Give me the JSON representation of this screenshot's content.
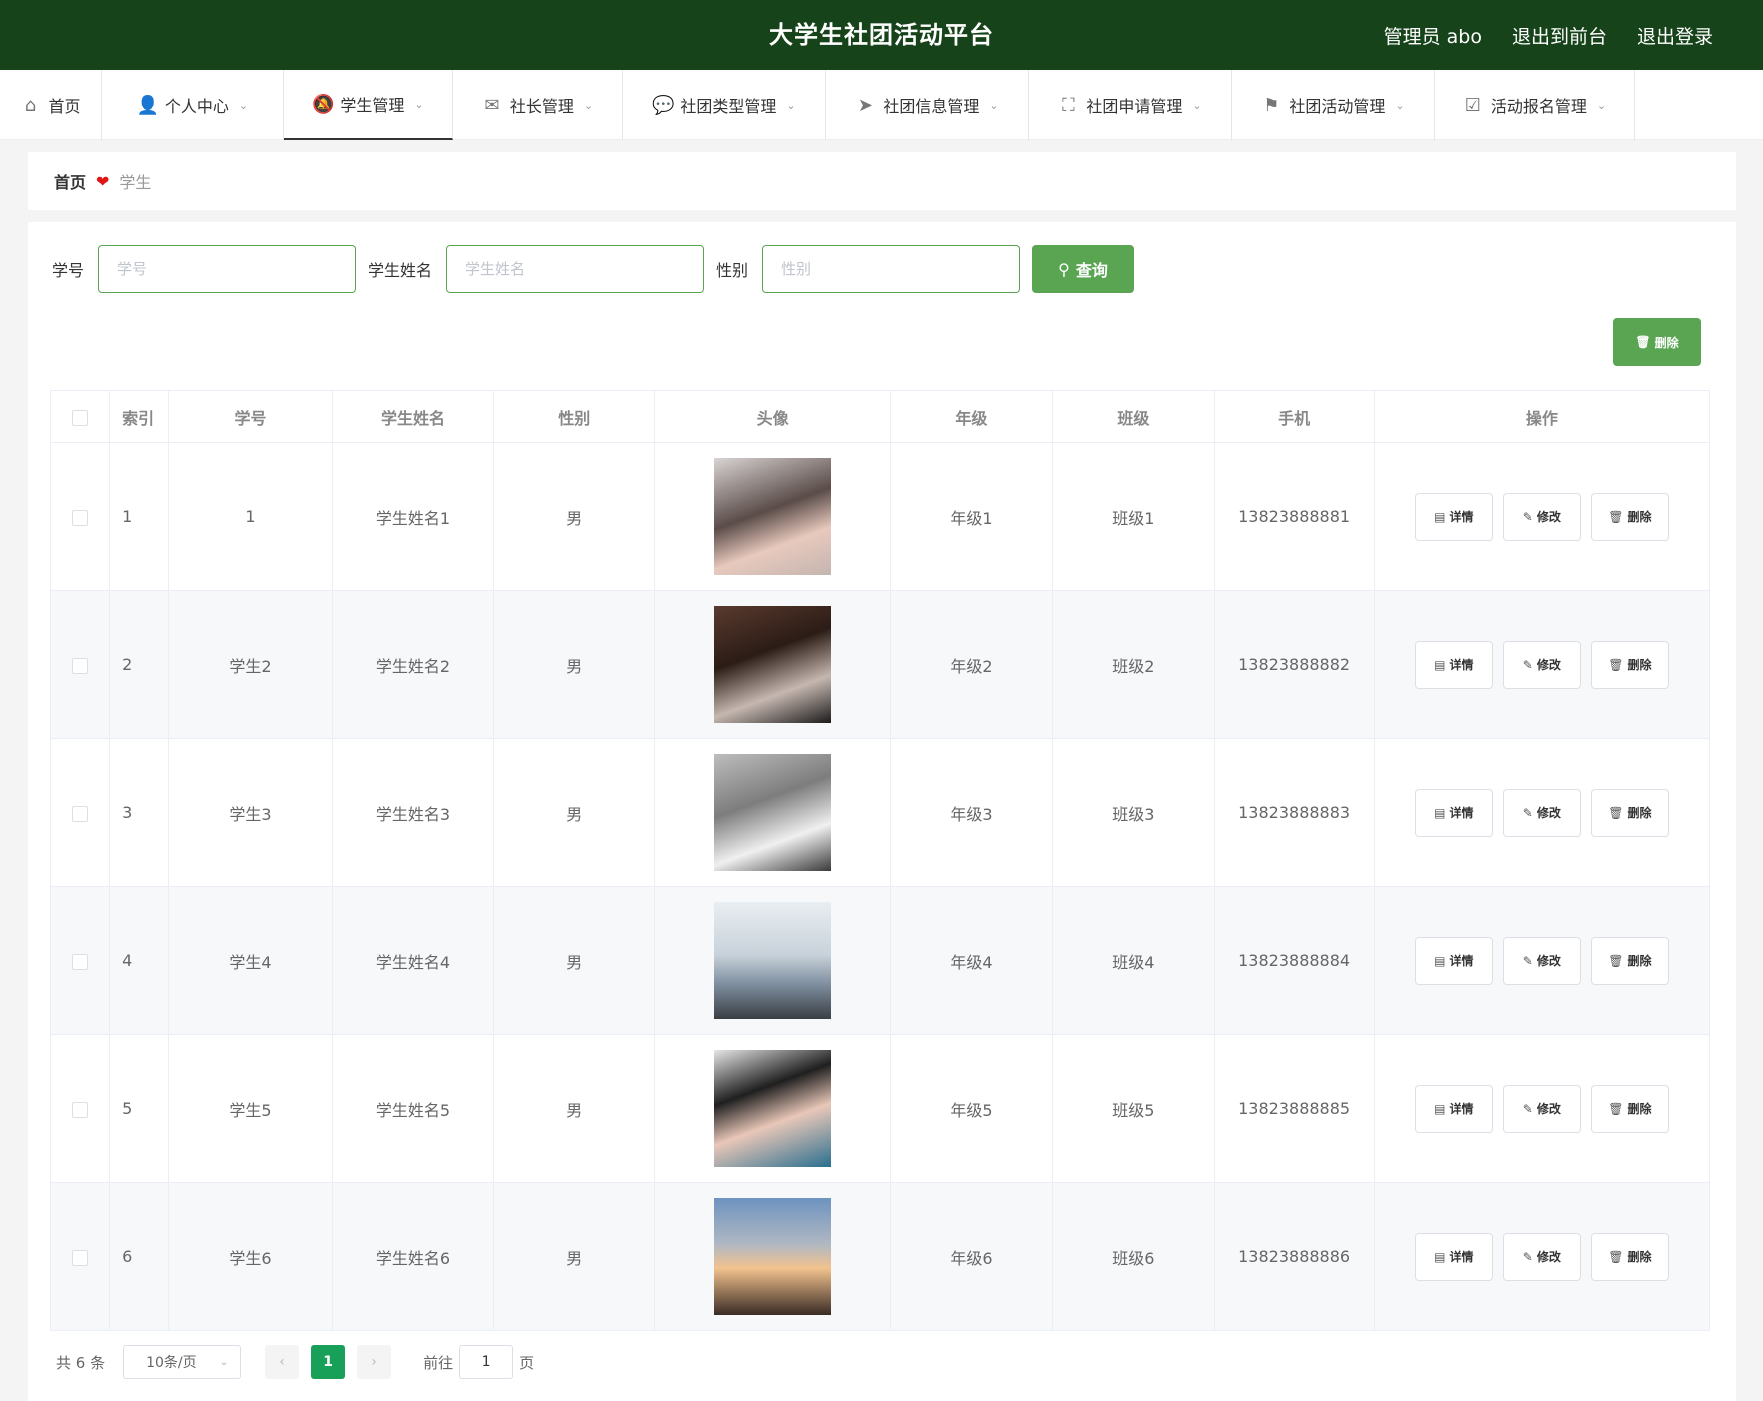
{
  "header": {
    "title": "大学生社团活动平台",
    "admin": "管理员 abo",
    "to_front": "退出到前台",
    "logout": "退出登录",
    "bg_color": "#164319"
  },
  "nav": [
    {
      "label": "首页",
      "icon": "home-icon",
      "has_menu": false
    },
    {
      "label": "个人中心",
      "icon": "user-icon",
      "has_menu": true
    },
    {
      "label": "学生管理",
      "icon": "bell-off-icon",
      "has_menu": true,
      "active": true
    },
    {
      "label": "社长管理",
      "icon": "mail-icon",
      "has_menu": true
    },
    {
      "label": "社团类型管理",
      "icon": "chat-icon",
      "has_menu": true
    },
    {
      "label": "社团信息管理",
      "icon": "send-icon",
      "has_menu": true
    },
    {
      "label": "社团申请管理",
      "icon": "fullscreen-icon",
      "has_menu": true
    },
    {
      "label": "社团活动管理",
      "icon": "flag-icon",
      "has_menu": true
    },
    {
      "label": "活动报名管理",
      "icon": "clipboard-check-icon",
      "has_menu": true
    }
  ],
  "breadcrumb": {
    "home": "首页",
    "current": "学生"
  },
  "search": {
    "fields": [
      {
        "label": "学号",
        "placeholder": "学号",
        "value": ""
      },
      {
        "label": "学生姓名",
        "placeholder": "学生姓名",
        "value": ""
      },
      {
        "label": "性别",
        "placeholder": "性别",
        "value": ""
      }
    ],
    "query_label": "查询"
  },
  "toolbar": {
    "delete_label": "删除"
  },
  "table": {
    "columns": [
      "索引",
      "学号",
      "学生姓名",
      "性别",
      "头像",
      "年级",
      "班级",
      "手机",
      "操作"
    ],
    "rows": [
      {
        "index": "1",
        "id": "1",
        "name": "学生姓名1",
        "gender": "男",
        "grade": "年级1",
        "class": "班级1",
        "phone": "13823888881"
      },
      {
        "index": "2",
        "id": "学生2",
        "name": "学生姓名2",
        "gender": "男",
        "grade": "年级2",
        "class": "班级2",
        "phone": "13823888882"
      },
      {
        "index": "3",
        "id": "学生3",
        "name": "学生姓名3",
        "gender": "男",
        "grade": "年级3",
        "class": "班级3",
        "phone": "13823888883"
      },
      {
        "index": "4",
        "id": "学生4",
        "name": "学生姓名4",
        "gender": "男",
        "grade": "年级4",
        "class": "班级4",
        "phone": "13823888884"
      },
      {
        "index": "5",
        "id": "学生5",
        "name": "学生姓名5",
        "gender": "男",
        "grade": "年级5",
        "class": "班级5",
        "phone": "13823888885"
      },
      {
        "index": "6",
        "id": "学生6",
        "name": "学生姓名6",
        "gender": "男",
        "grade": "年级6",
        "class": "班级6",
        "phone": "13823888886"
      }
    ],
    "actions": {
      "detail": "详情",
      "edit": "修改",
      "delete": "删除"
    }
  },
  "pagination": {
    "total": "共 6 条",
    "page_size": "10条/页",
    "current_page": "1",
    "goto_prefix": "前往",
    "goto_value": "1",
    "goto_suffix": "页"
  },
  "colors": {
    "accent": "#5aa552",
    "page_active": "#18a058"
  }
}
